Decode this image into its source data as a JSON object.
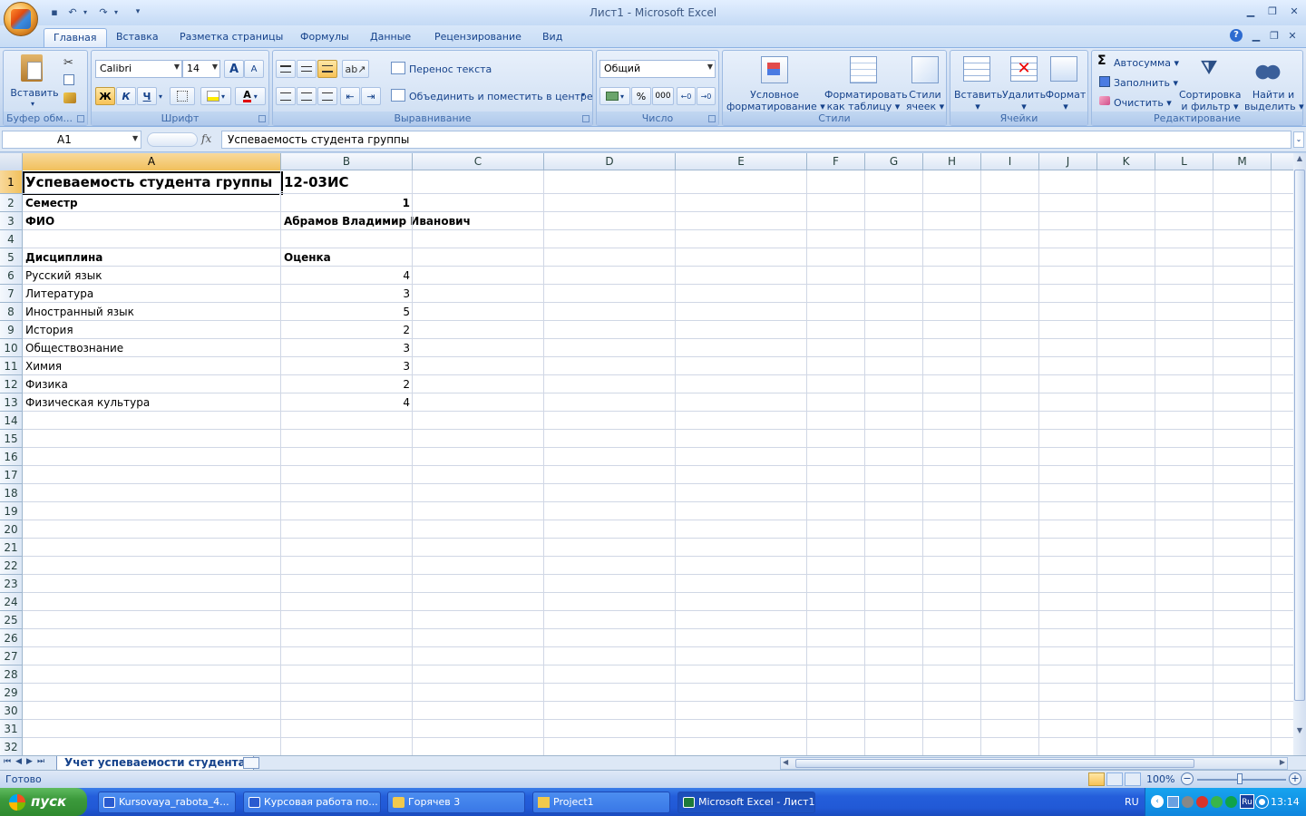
{
  "window": {
    "title": "Лист1 - Microsoft Excel"
  },
  "ribbon_tabs": [
    "Главная",
    "Вставка",
    "Разметка страницы",
    "Формулы",
    "Данные",
    "Рецензирование",
    "Вид"
  ],
  "clipboard": {
    "paste": "Вставить",
    "group": "Буфер обм..."
  },
  "font": {
    "name": "Calibri",
    "size": "14",
    "bold": "Ж",
    "italic": "К",
    "underline": "Ч",
    "grow": "A",
    "shrink": "A",
    "color_letter": "A",
    "group": "Шрифт"
  },
  "alignment": {
    "wrap": "Перенос текста",
    "merge": "Объединить и поместить в центре",
    "group": "Выравнивание"
  },
  "number": {
    "format": "Общий",
    "percent": "%",
    "thousands": "000",
    "group": "Число"
  },
  "styles": {
    "cond1": "Условное",
    "cond2": "форматирование",
    "table1": "Форматировать",
    "table2": "как таблицу",
    "cell1": "Стили",
    "cell2": "ячеек",
    "group": "Стили"
  },
  "cells": {
    "insert": "Вставить",
    "delete": "Удалить",
    "format": "Формат",
    "group": "Ячейки"
  },
  "editing": {
    "autosum": "Автосумма",
    "fill": "Заполнить",
    "clear": "Очистить",
    "sort1": "Сортировка",
    "sort2": "и фильтр",
    "find1": "Найти и",
    "find2": "выделить",
    "group": "Редактирование",
    "sigma": "Σ"
  },
  "formula_bar": {
    "name_box": "A1",
    "fx": "fx",
    "content": "Успеваемость студента группы"
  },
  "columns": [
    "A",
    "B",
    "C",
    "D",
    "E",
    "F",
    "G",
    "H",
    "I",
    "J",
    "K",
    "L",
    "M"
  ],
  "rows": [
    "1",
    "2",
    "3",
    "4",
    "5",
    "6",
    "7",
    "8",
    "9",
    "10",
    "11",
    "12",
    "13",
    "14",
    "15",
    "16",
    "17",
    "18",
    "19",
    "20",
    "21",
    "22",
    "23",
    "24",
    "25",
    "26",
    "27",
    "28",
    "29",
    "30",
    "31",
    "32"
  ],
  "sheet": {
    "a1": "Успеваемость студента группы",
    "b1": "12-03ИС",
    "a2": "Семестр",
    "b2": "1",
    "a3": "ФИО",
    "b3": "Абрамов Владимир Иванович",
    "a5": "Дисциплина",
    "b5": "Оценка",
    "subjects": [
      {
        "name": "Русский язык",
        "grade": "4"
      },
      {
        "name": "Литература",
        "grade": "3"
      },
      {
        "name": "Иностранный язык",
        "grade": "5"
      },
      {
        "name": "История",
        "grade": "2"
      },
      {
        "name": "Обществознание",
        "grade": "3"
      },
      {
        "name": "Химия",
        "grade": "3"
      },
      {
        "name": "Физика",
        "grade": "2"
      },
      {
        "name": "Физическая культура",
        "grade": "4"
      }
    ]
  },
  "sheet_tab": "Учет успеваемости студента",
  "status": {
    "ready": "Готово",
    "zoom": "100%"
  },
  "taskbar": {
    "start": "пуск",
    "items": [
      "Kursovaya_rabota_4...",
      "Курсовая работа по...",
      "Горячев 3",
      "Project1",
      "Microsoft Excel - Лист1"
    ],
    "lang": "RU",
    "time": "13:14",
    "lang_icon": "Ru"
  }
}
